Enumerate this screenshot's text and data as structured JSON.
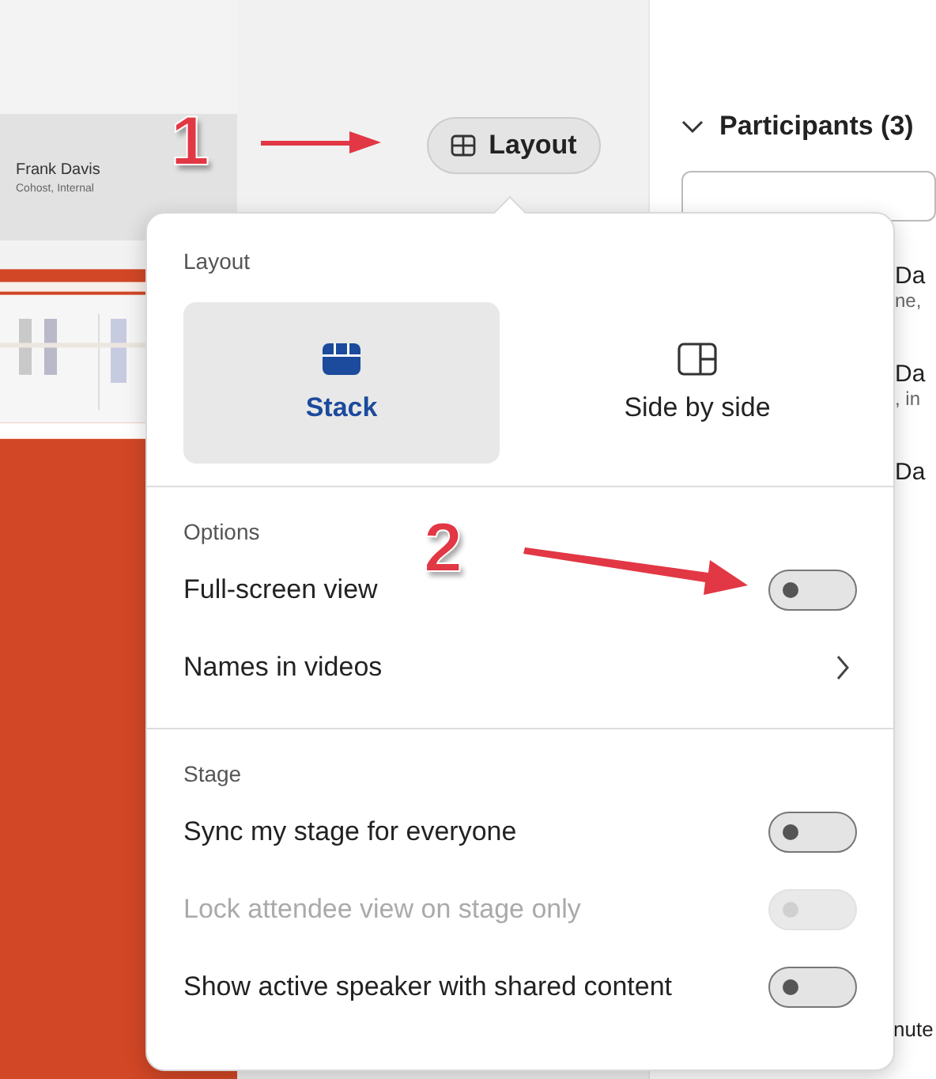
{
  "video_tile": {
    "name": "Frank Davis",
    "role": "Cohost, Internal"
  },
  "annotations": [
    {
      "label": "1"
    },
    {
      "label": "2"
    }
  ],
  "layout_button": {
    "label": "Layout"
  },
  "participants_panel": {
    "title": "Participants (3)",
    "rows": [
      {
        "name": "Da",
        "detail": "ne,"
      },
      {
        "name": "Da",
        "detail": ", in"
      },
      {
        "name": "Da"
      }
    ],
    "footer": "nute"
  },
  "popup": {
    "layout_heading": "Layout",
    "layouts": [
      {
        "kind": "stack",
        "label": "Stack",
        "selected": true
      },
      {
        "kind": "side",
        "label": "Side by side",
        "selected": false
      }
    ],
    "options_heading": "Options",
    "options": [
      {
        "kind": "toggle",
        "label": "Full-screen view",
        "on": false
      },
      {
        "kind": "submenu",
        "label": "Names in videos"
      }
    ],
    "stage_heading": "Stage",
    "stage_options": [
      {
        "label": "Sync my stage for everyone",
        "on": false,
        "disabled": false
      },
      {
        "label": "Lock attendee view on stage only",
        "on": false,
        "disabled": true
      },
      {
        "label": "Show active speaker with shared content",
        "on": false,
        "disabled": false
      }
    ]
  }
}
